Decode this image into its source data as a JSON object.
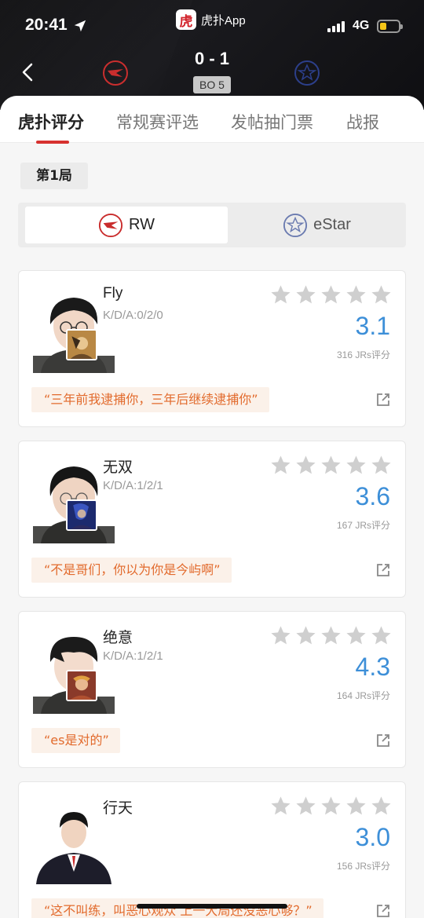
{
  "status_bar": {
    "time": "20:41",
    "network": "4G"
  },
  "app_badge": {
    "logo_char": "虎",
    "name": "虎扑App"
  },
  "match": {
    "score": "0 - 1",
    "format": "BO 5"
  },
  "tabs": [
    {
      "label": "虎扑评分",
      "active": true
    },
    {
      "label": "常规赛评选",
      "active": false
    },
    {
      "label": "发帖抽门票",
      "active": false
    },
    {
      "label": "战报",
      "active": false
    }
  ],
  "round_label": "第1局",
  "teams": {
    "left": "RW",
    "right": "eStar",
    "selected": "RW"
  },
  "players": [
    {
      "name": "Fly",
      "kda": "K/D/A:0/2/0",
      "rating": "3.1",
      "votes": "316 JRs评分",
      "quote": "“三年前我逮捕你，三年后继续逮捕你”"
    },
    {
      "name": "无双",
      "kda": "K/D/A:1/2/1",
      "rating": "3.6",
      "votes": "167 JRs评分",
      "quote": "“不是哥们，你以为你是今屿啊”"
    },
    {
      "name": "绝意",
      "kda": "K/D/A:1/2/1",
      "rating": "4.3",
      "votes": "164 JRs评分",
      "quote": "“es是对的”"
    },
    {
      "name": "行天",
      "kda": "",
      "rating": "3.0",
      "votes": "156 JRs评分",
      "quote": "“这不叫练，叫恶心观众 上一大局还没恶心够？”"
    }
  ],
  "colors": {
    "accent_red": "#d6312f",
    "rating_blue": "#3d8fd8",
    "quote_orange": "#e26a2c"
  }
}
